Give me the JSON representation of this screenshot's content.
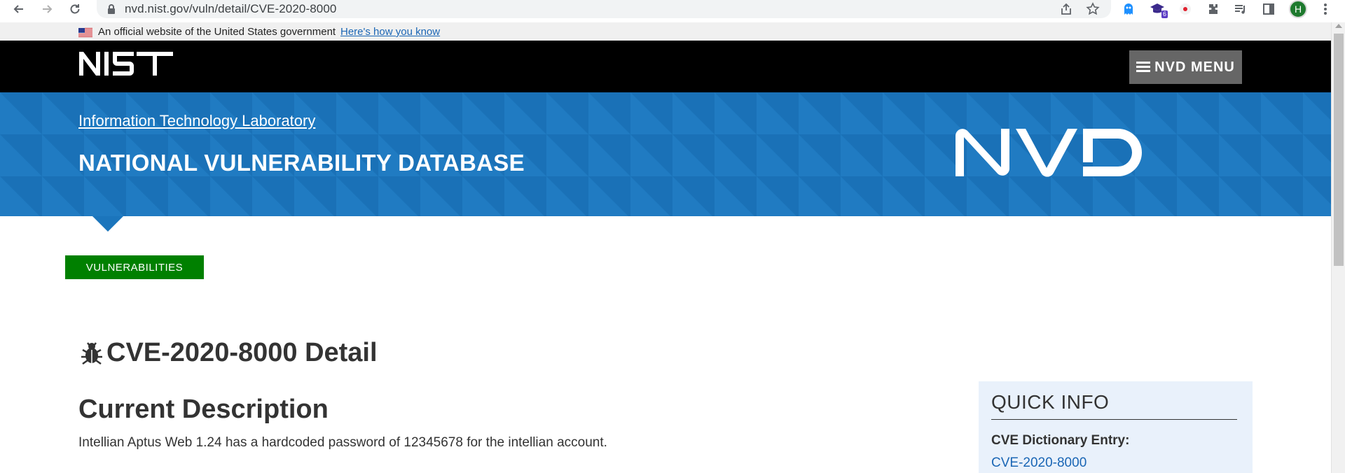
{
  "browser": {
    "url": "nvd.nist.gov/vuln/detail/CVE-2020-8000",
    "profile_initial": "H",
    "extension_badge": "6",
    "icons": [
      "back-icon",
      "forward-icon",
      "reload-icon",
      "lock-icon",
      "share-icon",
      "star-icon",
      "ghost-extension-icon",
      "graduation-extension-icon",
      "record-extension-icon",
      "puzzle-extensions-icon",
      "media-queue-icon",
      "side-panel-icon",
      "kebab-menu-icon"
    ]
  },
  "gov_banner": {
    "text": "An official website of the United States government",
    "link": "Here's how you know"
  },
  "header": {
    "nist_logo": "NIST",
    "menu_label": "NVD MENU"
  },
  "banner": {
    "itl_link": "Information Technology Laboratory",
    "title": "NATIONAL VULNERABILITY DATABASE",
    "logo_text": "NVD"
  },
  "tabs": {
    "vulnerabilities": "VULNERABILITIES"
  },
  "main": {
    "page_title": "CVE-2020-8000 Detail",
    "section_title": "Current Description",
    "description": "Intellian Aptus Web 1.24 has a hardcoded password of 12345678 for the intellian account."
  },
  "quick_info": {
    "title": "QUICK INFO",
    "cve_label": "CVE Dictionary Entry:",
    "cve_value": "CVE-2020-8000"
  },
  "colors": {
    "banner_blue": "#1b75bc",
    "vuln_tab_green": "#008000",
    "link_blue": "#1a66b5",
    "menu_gray": "#666666",
    "quick_info_bg": "#e9f1fb"
  }
}
